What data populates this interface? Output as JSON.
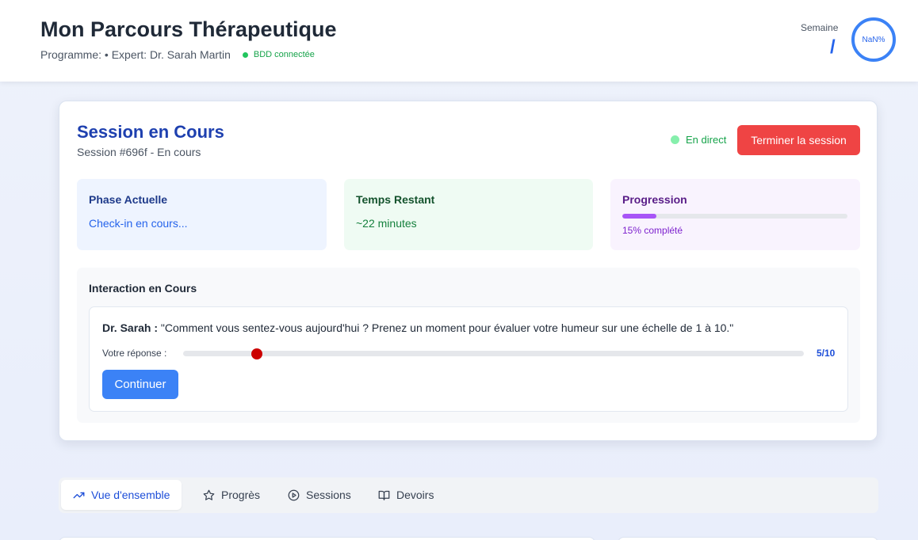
{
  "header": {
    "title": "Mon Parcours Thérapeutique",
    "subtitle": "Programme: • Expert: Dr. Sarah Martin",
    "db_status": "BDD connectée",
    "week_label": "Semaine",
    "week_value": "/",
    "week_percent": "NaN%",
    "colors": {
      "accent": "#3b82f6",
      "db_ok": "#22c55e"
    }
  },
  "session": {
    "title": "Session en Cours",
    "subtitle": "Session #696f - En cours",
    "live_label": "En direct",
    "end_button": "Terminer la session",
    "phase": {
      "title": "Phase Actuelle",
      "value": "Check-in en cours..."
    },
    "time": {
      "title": "Temps Restant",
      "value": "~22 minutes"
    },
    "progress": {
      "title": "Progression",
      "percent": 15,
      "text": "15% complété"
    },
    "interaction": {
      "title": "Interaction en Cours",
      "speaker": "Dr. Sarah :",
      "question": "\"Comment vous sentez-vous aujourd'hui ? Prenez un moment pour évaluer votre humeur sur une échelle de 1 à 10.\"",
      "response_label": "Votre réponse :",
      "slider": {
        "min": 1,
        "max": 10,
        "value": 2.07
      },
      "value_text": "5/10",
      "continue_button": "Continuer"
    },
    "colors": {
      "end_button": "#ef4444",
      "progress": "#a855f7",
      "slider_thumb": "#cc0000"
    }
  },
  "tabs": [
    {
      "label": "Vue d'ensemble",
      "icon": "trending-up-icon",
      "active": true
    },
    {
      "label": "Progrès",
      "icon": "star-icon",
      "active": false
    },
    {
      "label": "Sessions",
      "icon": "play-circle-icon",
      "active": false
    },
    {
      "label": "Devoirs",
      "icon": "book-open-icon",
      "active": false
    }
  ]
}
